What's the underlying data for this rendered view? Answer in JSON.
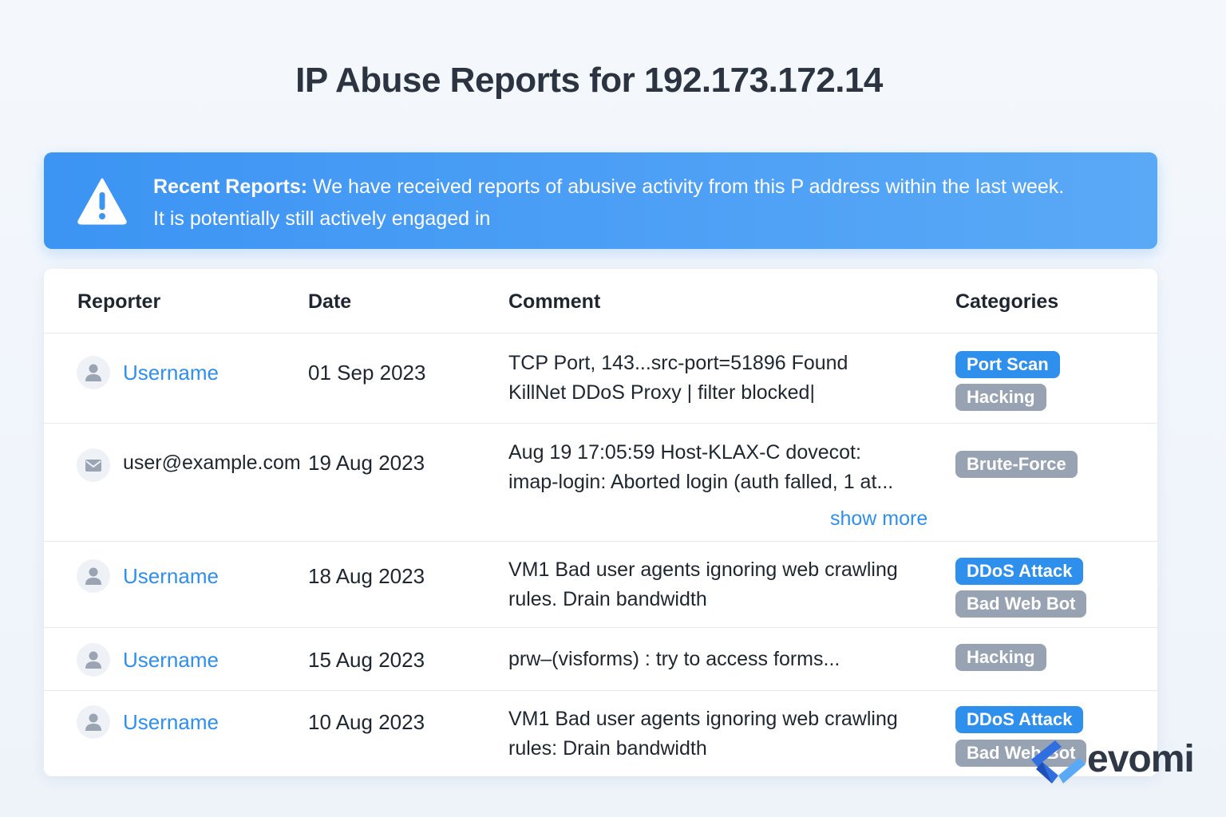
{
  "page": {
    "title": "IP Abuse Reports for 192.173.172.14"
  },
  "alert": {
    "icon": "warning-triangle-icon",
    "bold_label": "Recent Reports:",
    "message_line1": "We have received reports of abusive activity from this P address within the last week.",
    "message_line2": "It is potentially still actively engaged in",
    "color": "#3c94f3"
  },
  "table": {
    "headers": {
      "reporter": "Reporter",
      "date": "Date",
      "comment": "Comment",
      "categories": "Categories"
    },
    "rows": [
      {
        "reporter": "Username",
        "reporter_icon": "user-icon",
        "date": "01 Sep 2023",
        "comment_line1": "TCP Port, 143...src-port=51896 Found",
        "comment_line2": "KillNet DDoS Proxy | filter blocked|",
        "categories": [
          {
            "label": "Port Scan",
            "color": "blue"
          },
          {
            "label": "Hacking",
            "color": "gray"
          }
        ]
      },
      {
        "reporter": "user@example.com",
        "reporter_icon": "mail-icon",
        "date": "19 Aug 2023",
        "comment_line1": "Aug 19 17:05:59 Host-KLAX-C dovecot:",
        "comment_line2": "imap-login: Aborted login (auth falled, 1 at...",
        "show_more": "show more",
        "categories": [
          {
            "label": "Brute-Force",
            "color": "gray"
          }
        ]
      },
      {
        "reporter": "Username",
        "reporter_icon": "user-icon",
        "date": "18 Aug 2023",
        "comment_line1": "VM1 Bad user agents ignoring web crawling",
        "comment_line2": "rules. Drain bandwidth",
        "categories": [
          {
            "label": "DDoS Attack",
            "color": "blue"
          },
          {
            "label": "Bad Web Bot",
            "color": "gray"
          }
        ]
      },
      {
        "reporter": "Username",
        "reporter_icon": "user-icon",
        "date": "15 Aug 2023",
        "comment_line1": "prw–(visforms) : try to access forms...",
        "categories": [
          {
            "label": "Hacking",
            "color": "gray"
          }
        ]
      },
      {
        "reporter": "Username",
        "reporter_icon": "user-icon",
        "date": "10 Aug 2023",
        "comment_line1": "VM1 Bad user agents ignoring web crawling",
        "comment_line2": "rules: Drain bandwidth",
        "categories": [
          {
            "label": "DDoS Attack",
            "color": "blue"
          },
          {
            "label": "Bad Web Bot",
            "color": "gray"
          }
        ]
      }
    ]
  },
  "colors": {
    "link": "#2f8fec",
    "badge_blue": "#2f8fec",
    "badge_gray": "#97a2b2"
  },
  "brand": {
    "name": "evomi",
    "icon": "evomi-logo-icon"
  }
}
